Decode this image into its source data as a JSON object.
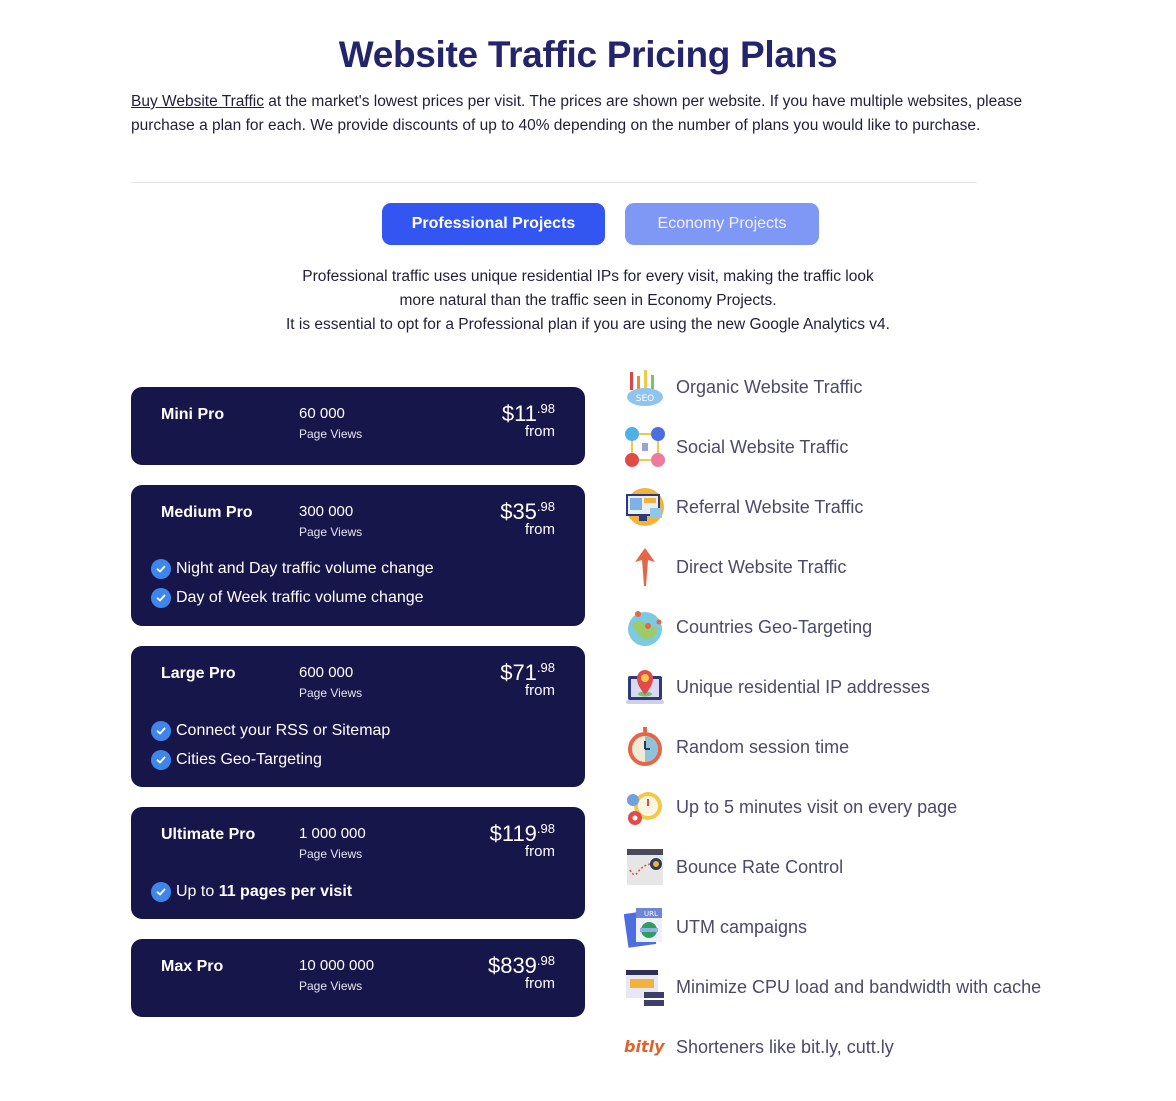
{
  "header": {
    "title": "Website Traffic Pricing Plans",
    "intro_link": "Buy Website Traffic",
    "intro_text": " at the market's lowest prices per visit. The prices are shown per website. If you have multiple websites, please purchase a plan for each. We provide discounts of up to 40% depending on the number of plans you would like to purchase."
  },
  "tabs": [
    {
      "label": "Professional Projects",
      "active": true
    },
    {
      "label": "Economy Projects",
      "active": false
    }
  ],
  "description": {
    "line1": "Professional traffic uses unique residential IPs for every visit, making the traffic look",
    "line2": "more natural than the traffic seen in Economy Projects.",
    "line3": "It is essential to opt for a Professional plan if you are using the new Google Analytics v4."
  },
  "plans": [
    {
      "name": "Mini Pro",
      "views": "60 000",
      "views_label": "Page Views",
      "price_main": "$11",
      "price_cents": ".98",
      "from": "from",
      "features": []
    },
    {
      "name": "Medium Pro",
      "views": "300 000",
      "views_label": "Page Views",
      "price_main": "$35",
      "price_cents": ".98",
      "from": "from",
      "features": [
        "Night and Day traffic volume change",
        "Day of Week traffic volume change"
      ]
    },
    {
      "name": "Large Pro",
      "views": "600 000",
      "views_label": "Page Views",
      "price_main": "$71",
      "price_cents": ".98",
      "from": "from",
      "features": [
        "Connect your RSS or Sitemap",
        "Cities Geo-Targeting"
      ]
    },
    {
      "name": "Ultimate Pro",
      "views": "1 000 000",
      "views_label": "Page Views",
      "price_main": "$119",
      "price_cents": ".98",
      "from": "from",
      "features": [
        "Up to 11 pages per visit"
      ]
    },
    {
      "name": "Max Pro",
      "views": "10 000 000",
      "views_label": "Page Views",
      "price_main": "$839",
      "price_cents": ".98",
      "from": "from",
      "features": []
    }
  ],
  "features_list": [
    {
      "icon": "seo-cloud-icon",
      "label": "Organic Website Traffic"
    },
    {
      "icon": "social-media-icon",
      "label": "Social Website Traffic"
    },
    {
      "icon": "referral-monitor-icon",
      "label": "Referral Website Traffic"
    },
    {
      "icon": "arrow-up-icon",
      "label": "Direct Website Traffic"
    },
    {
      "icon": "globe-pins-icon",
      "label": "Countries Geo-Targeting"
    },
    {
      "icon": "ip-location-icon",
      "label": "Unique residential IP addresses"
    },
    {
      "icon": "stopwatch-icon",
      "label": "Random session time"
    },
    {
      "icon": "timer-gears-icon",
      "label": "Up to 5 minutes visit on every page"
    },
    {
      "icon": "bounce-browser-icon",
      "label": "Bounce Rate Control"
    },
    {
      "icon": "url-document-icon",
      "label": "UTM campaigns"
    },
    {
      "icon": "cache-server-icon",
      "label": "Minimize CPU load and bandwidth with cache"
    },
    {
      "icon": "bitly-logo-icon",
      "label": "Shorteners like bit.ly, cutt.ly"
    }
  ],
  "colors": {
    "title": "#23246b",
    "card_bg": "#17164a",
    "tab_active": "#3356f2",
    "tab_inactive": "#7f98f6",
    "check": "#3f86ea"
  }
}
